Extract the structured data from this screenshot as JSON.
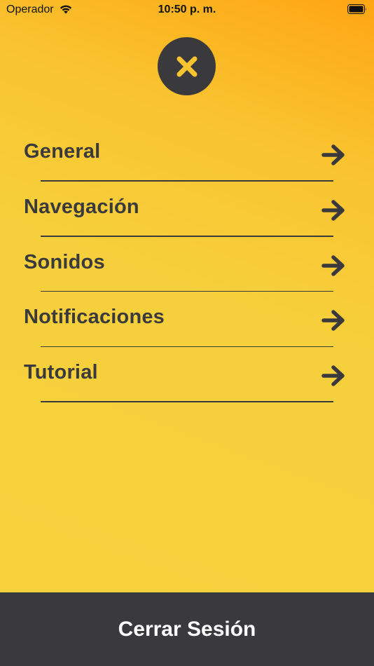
{
  "status_bar": {
    "carrier": "Operador",
    "time": "10:50 p. m."
  },
  "close": {
    "icon": "close-icon"
  },
  "menu": {
    "items": [
      {
        "label": "General",
        "icon": "arrow-right-icon"
      },
      {
        "label": "Navegación",
        "icon": "arrow-right-icon"
      },
      {
        "label": "Sonidos",
        "icon": "arrow-right-icon"
      },
      {
        "label": "Notificaciones",
        "icon": "arrow-right-icon"
      },
      {
        "label": "Tutorial",
        "icon": "arrow-right-icon"
      }
    ]
  },
  "footer": {
    "logout_label": "Cerrar Sesión"
  },
  "colors": {
    "accent_orange": "#ffa514",
    "background_yellow": "#f7d23d",
    "dark": "#3a3a3c",
    "close_x": "#f9c430",
    "footer_text": "#ffffff"
  }
}
